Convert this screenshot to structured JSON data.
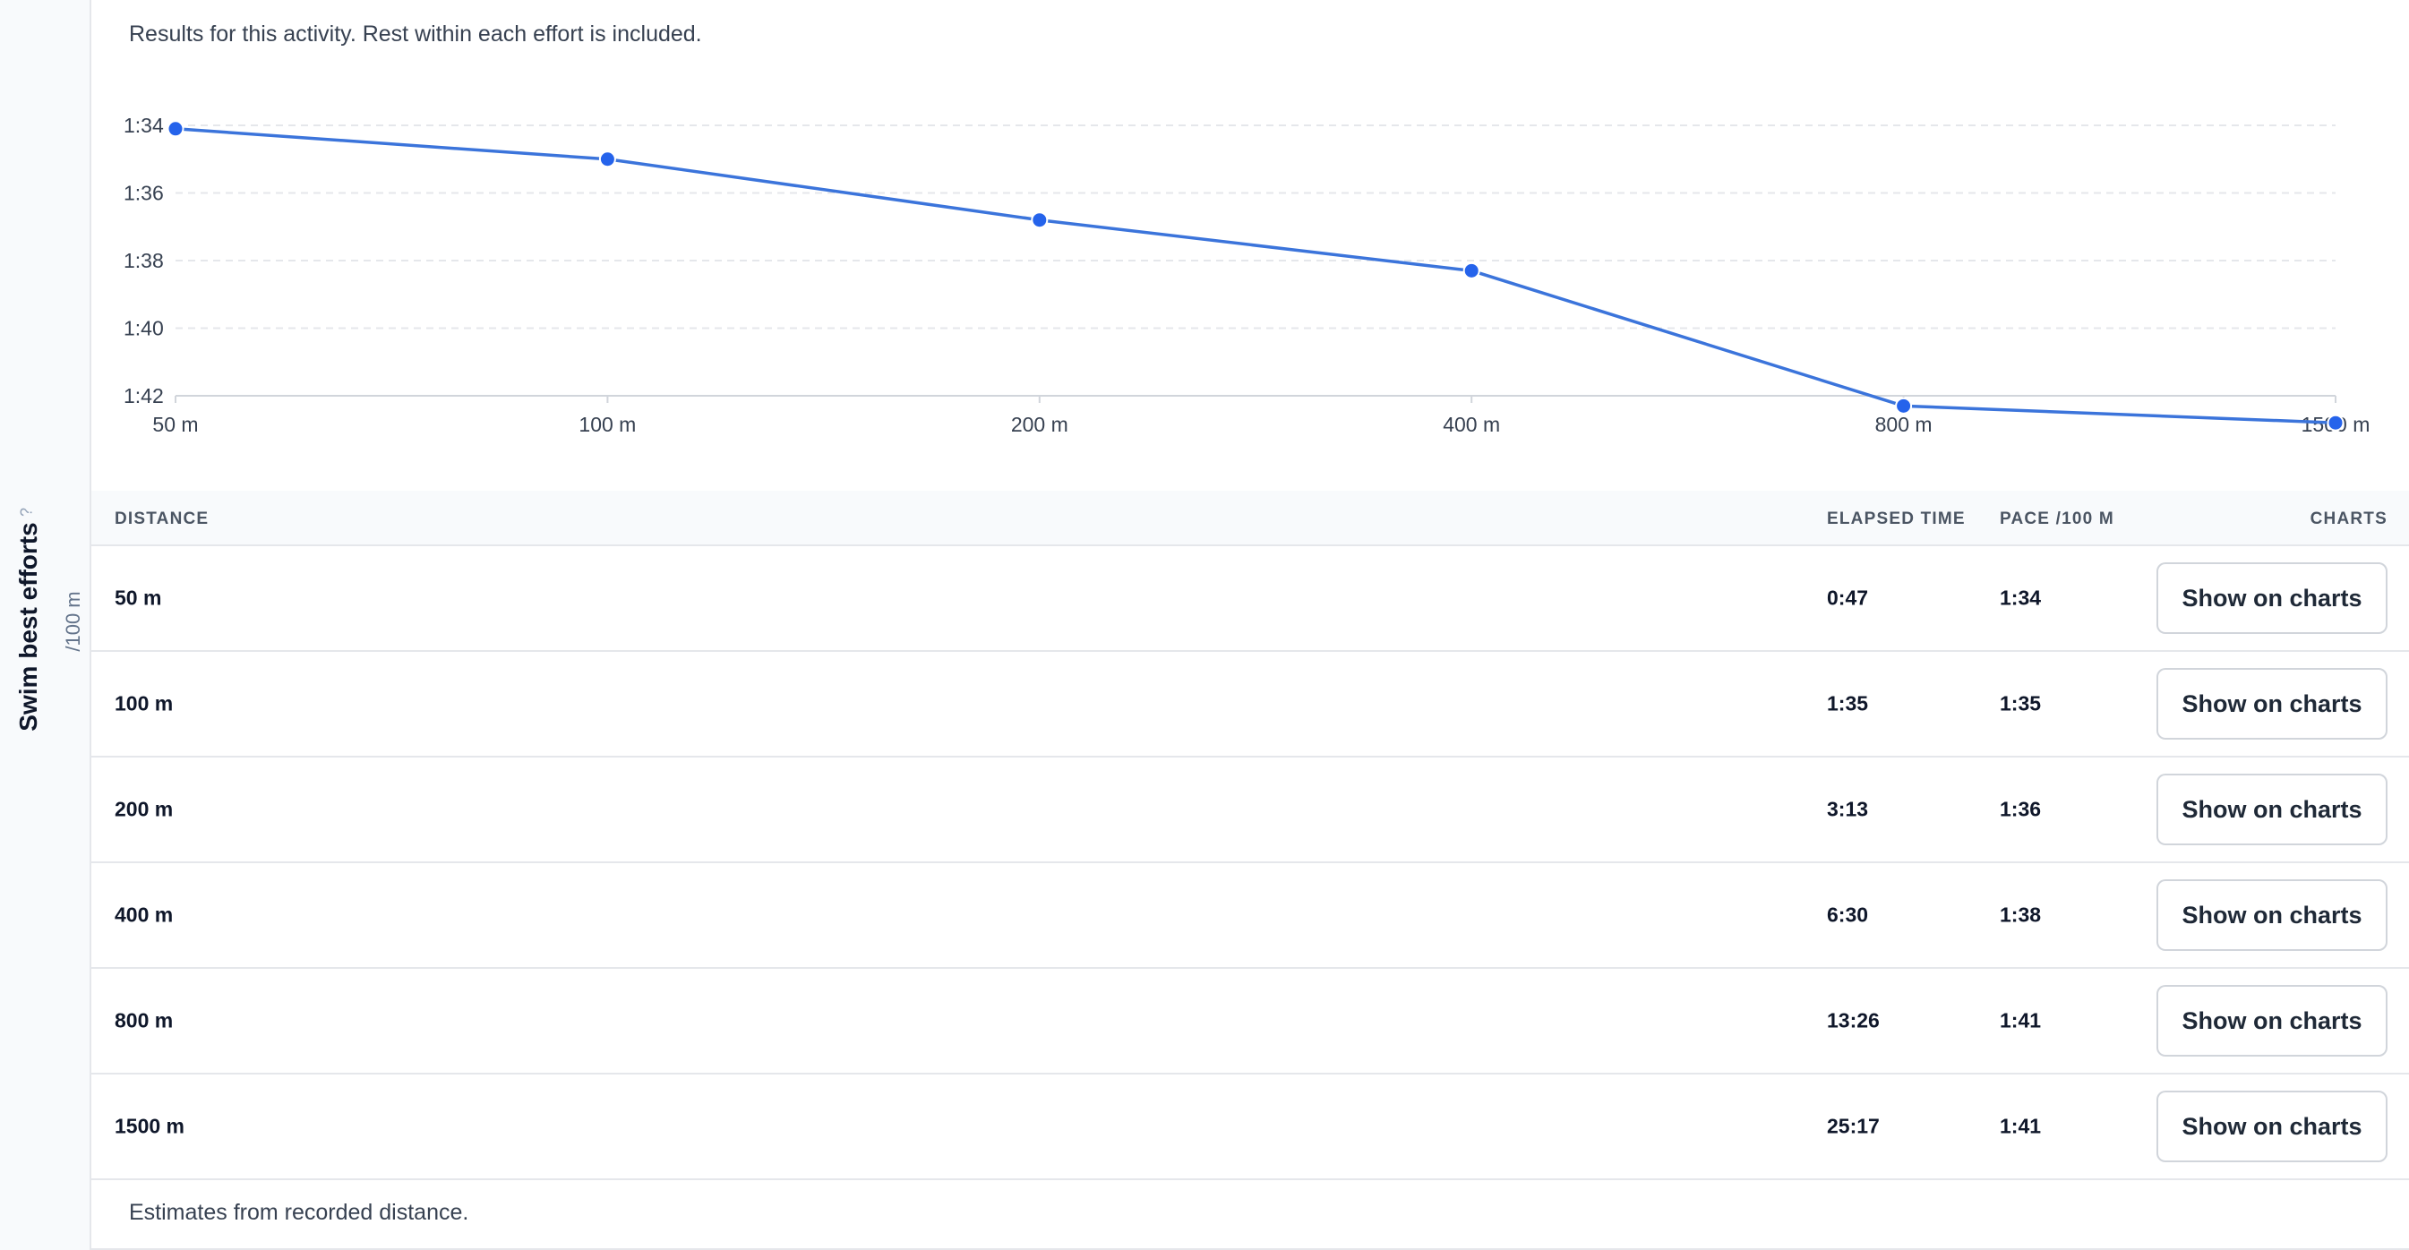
{
  "sidebar": {
    "title": "Swim best efforts",
    "subtitle": "/100 m",
    "help": "?"
  },
  "intro": "Results for this activity. Rest within each effort is included.",
  "chart_data": {
    "type": "line",
    "categories": [
      "50 m",
      "100 m",
      "200 m",
      "400 m",
      "800 m",
      "1500 m"
    ],
    "series": [
      {
        "values": [
          "1:34",
          "1:35",
          "1:36",
          "1:38",
          "1:41",
          "1:41"
        ],
        "seconds": [
          94.1,
          95.0,
          96.8,
          98.3,
          102.3,
          102.8
        ]
      }
    ],
    "y_ticks": [
      "1:34",
      "1:36",
      "1:38",
      "1:40",
      "1:42"
    ],
    "y_tick_seconds": [
      94,
      96,
      98,
      100,
      102
    ],
    "ylim_seconds": [
      94,
      102
    ],
    "y_inverted": true,
    "grid": true,
    "color": "#3b74db"
  },
  "table": {
    "headers": {
      "distance": "DISTANCE",
      "elapsed": "ELAPSED TIME",
      "pace": "PACE /100 M",
      "charts": "CHARTS"
    },
    "rows": [
      {
        "distance": "50 m",
        "elapsed": "0:47",
        "pace": "1:34",
        "action": "Show on charts"
      },
      {
        "distance": "100 m",
        "elapsed": "1:35",
        "pace": "1:35",
        "action": "Show on charts"
      },
      {
        "distance": "200 m",
        "elapsed": "3:13",
        "pace": "1:36",
        "action": "Show on charts"
      },
      {
        "distance": "400 m",
        "elapsed": "6:30",
        "pace": "1:38",
        "action": "Show on charts"
      },
      {
        "distance": "800 m",
        "elapsed": "13:26",
        "pace": "1:41",
        "action": "Show on charts"
      },
      {
        "distance": "1500 m",
        "elapsed": "25:17",
        "pace": "1:41",
        "action": "Show on charts"
      }
    ]
  },
  "footnote": "Estimates from recorded distance."
}
